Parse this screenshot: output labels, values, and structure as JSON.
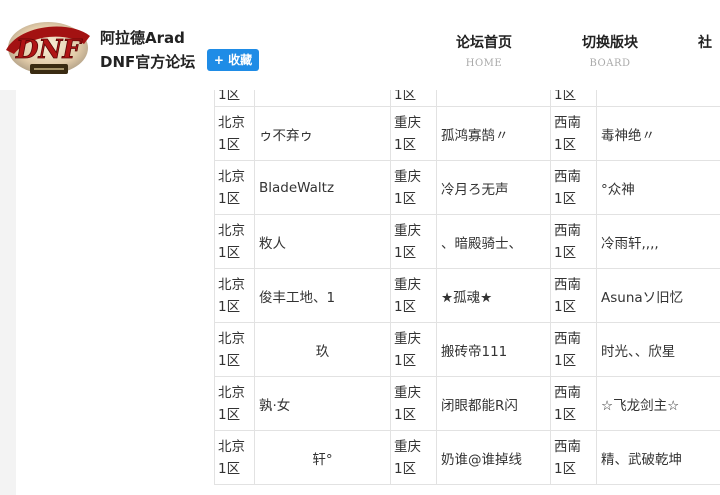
{
  "header": {
    "site_name_line1": "阿拉德Arad",
    "site_name_line2": "DNF官方论坛",
    "fav_label": "+ 收藏",
    "logo_text": "DNF"
  },
  "nav": [
    {
      "label": "论坛首页",
      "sub": "HOME"
    },
    {
      "label": "切换版块",
      "sub": "BOARD"
    },
    {
      "label": "社",
      "sub": ""
    }
  ],
  "table": {
    "partial_row": [
      "1区",
      "1区",
      "1区"
    ],
    "rows": [
      {
        "s1": "北京\n1区",
        "n1": "ゥ不弃ゥ",
        "s2": "重庆\n1区",
        "n2": "孤鸿寡鹄〃",
        "s3": "西南\n1区",
        "n3": "毒神绝〃",
        "c1": false
      },
      {
        "s1": "北京\n1区",
        "n1": "BladeWaltz",
        "s2": "重庆\n1区",
        "n2": "冷月ろ无声",
        "s3": "西南\n1区",
        "n3": "°众神",
        "c1": false
      },
      {
        "s1": "北京\n1区",
        "n1": "敉人",
        "s2": "重庆\n1区",
        "n2": "、暗殿骑士、",
        "s3": "西南\n1区",
        "n3": "冷雨轩,,,,",
        "c1": false
      },
      {
        "s1": "北京\n1区",
        "n1": "俊丰工地、1",
        "s2": "重庆\n1区",
        "n2": "★孤魂★",
        "s3": "西南\n1区",
        "n3": "Asunaソ旧忆",
        "c1": false
      },
      {
        "s1": "北京\n1区",
        "n1": "玖",
        "s2": "重庆\n1区",
        "n2": "搬砖帝111",
        "s3": "西南\n1区",
        "n3": "时光、、欣星",
        "c1": true
      },
      {
        "s1": "北京\n1区",
        "n1": "孰·女",
        "s2": "重庆\n1区",
        "n2": "闭眼都能R闪",
        "s3": "西南\n1区",
        "n3": "☆飞龙剑主☆",
        "c1": false
      },
      {
        "s1": "北京\n1区",
        "n1": "轩°",
        "s2": "重庆\n1区",
        "n2": "奶谁@谁掉线",
        "s3": "西南\n1区",
        "n3": "精、武破乾坤",
        "c1": true
      }
    ]
  }
}
